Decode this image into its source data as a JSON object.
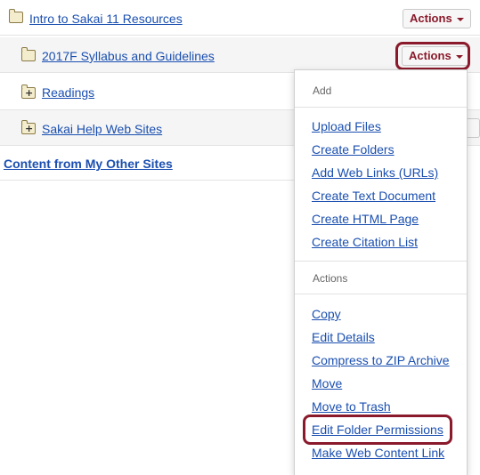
{
  "rows": [
    {
      "label": "Intro to Sakai 11 Resources",
      "actions": "Actions"
    },
    {
      "label": "2017F Syllabus and Guidelines",
      "actions": "Actions"
    },
    {
      "label": "Readings"
    },
    {
      "label": "Sakai Help Web Sites"
    }
  ],
  "other_sites": "Content from My Other Sites",
  "menu": {
    "add_header": "Add",
    "add_items": [
      "Upload Files",
      "Create Folders",
      "Add Web Links (URLs)",
      "Create Text Document",
      "Create HTML Page",
      "Create Citation List"
    ],
    "actions_header": "Actions",
    "action_items": [
      "Copy",
      "Edit Details",
      "Compress to ZIP Archive",
      "Move",
      "Move to Trash",
      "Edit Folder Permissions",
      "Make Web Content Link"
    ]
  },
  "colors": {
    "link": "#1a4fb0",
    "accent": "#8a1a2b"
  }
}
